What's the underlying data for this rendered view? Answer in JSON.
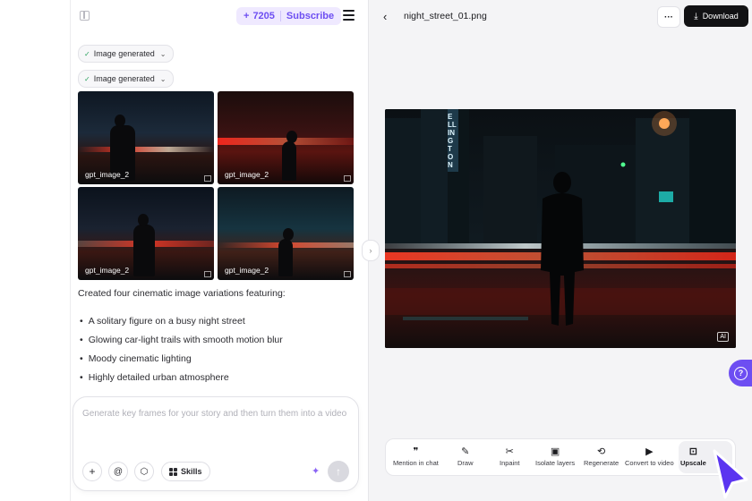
{
  "header": {
    "credits": "7205",
    "credits_plus": "+",
    "subscribe": "Subscribe"
  },
  "chat": {
    "chips": [
      "Image generated",
      "Image generated"
    ],
    "thumbnails": [
      {
        "label": "gpt_image_2"
      },
      {
        "label": "gpt_image_2"
      },
      {
        "label": "gpt_image_2"
      },
      {
        "label": "gpt_image_2"
      }
    ],
    "description": "Created four cinematic image variations featuring:",
    "bullets": [
      "A solitary figure on a busy night street",
      "Glowing car-light trails with smooth motion blur",
      "Moody cinematic lighting",
      "Highly detailed urban atmosphere"
    ],
    "composer": {
      "placeholder": "Generate key frames for your story and then turn them into a video",
      "plus": "+",
      "at": "@",
      "skills": "Skills",
      "send": "↑"
    }
  },
  "viewer": {
    "back": "‹",
    "filename": "night_street_01.png",
    "more": "···",
    "download": "Download",
    "ai_badge": "AI",
    "sign_text": "ELLINGTON"
  },
  "toolbar": {
    "tools": [
      {
        "label": "Mention in chat",
        "icon": "quote-icon",
        "glyph": "❞"
      },
      {
        "label": "Draw",
        "icon": "brush-icon",
        "glyph": "✎"
      },
      {
        "label": "Inpaint",
        "icon": "scissors-icon",
        "glyph": "✂"
      },
      {
        "label": "Isolate layers",
        "icon": "layers-image-icon",
        "glyph": "▣"
      },
      {
        "label": "Regenerate",
        "icon": "refresh-icon",
        "glyph": "⟲"
      },
      {
        "label": "Convert to video",
        "icon": "play-icon",
        "glyph": "▶"
      },
      {
        "label": "Upscale",
        "icon": "hd-icon",
        "glyph": "⊡"
      }
    ]
  },
  "colors": {
    "accent": "#6d4ef2",
    "download_bg": "#121214",
    "check": "#2ca25f"
  }
}
